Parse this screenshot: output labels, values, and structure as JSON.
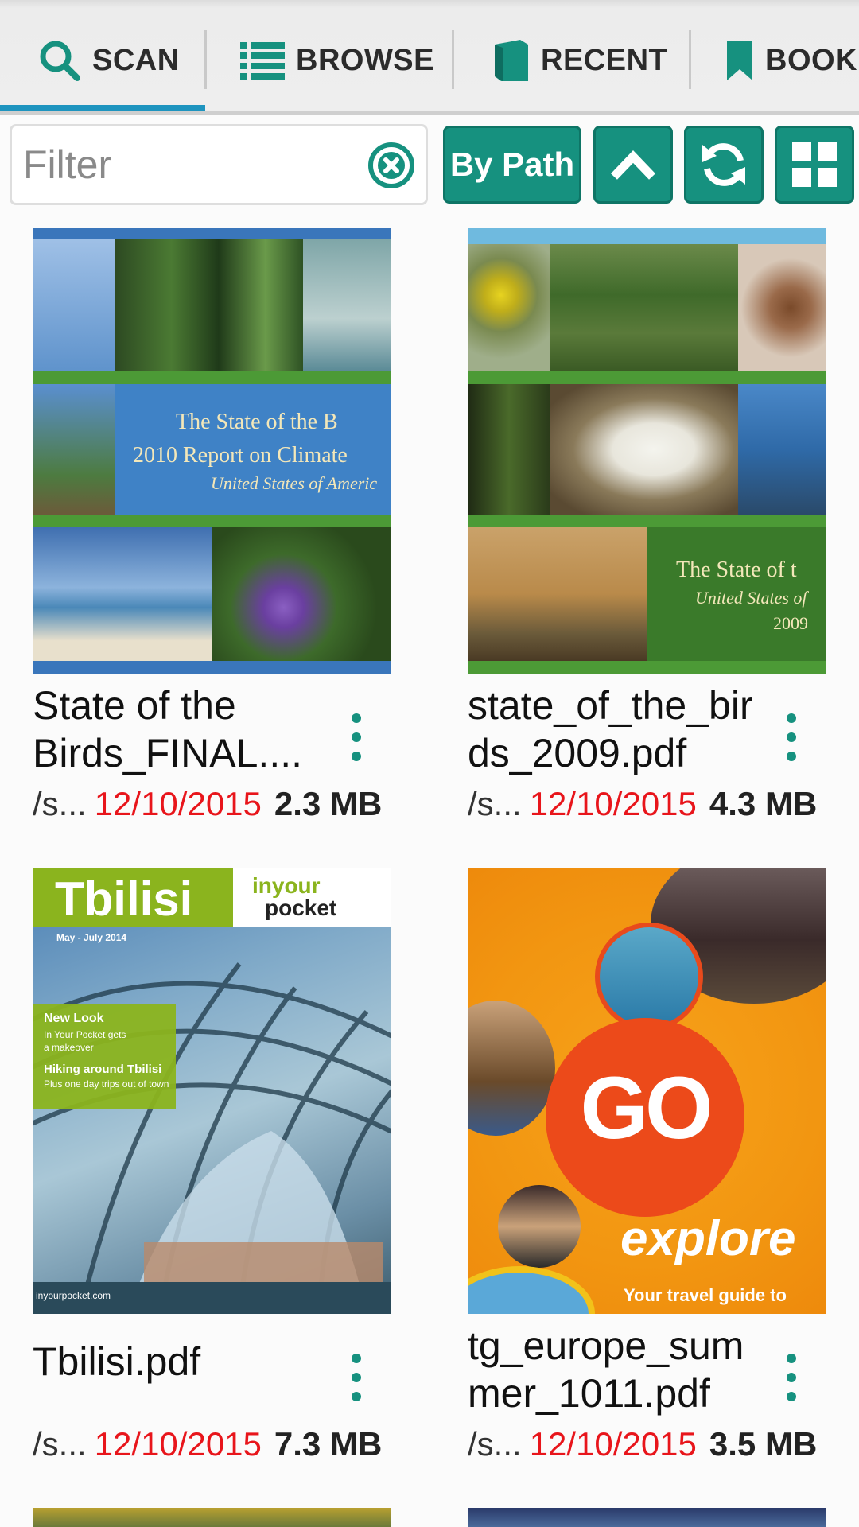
{
  "tabs": [
    {
      "label": "SCAN",
      "icon": "search-icon"
    },
    {
      "label": "BROWSE",
      "icon": "list-icon"
    },
    {
      "label": "RECENT",
      "icon": "book-icon"
    },
    {
      "label": "BOOKM",
      "icon": "bookmark-icon"
    }
  ],
  "toolbar": {
    "filter_placeholder": "Filter",
    "bypath_label": "By Path",
    "colors": {
      "accent": "#16917f",
      "tab_indicator": "#1e94bf",
      "date": "#e8151b"
    }
  },
  "files": [
    {
      "name": "State of the Birds_FINAL....",
      "path": "/s...",
      "date": "12/10/2015",
      "size": "2.3 MB",
      "cover": {
        "line1": "The State of the B",
        "line2": "2010 Report on Climate",
        "line3": "United States of Americ"
      }
    },
    {
      "name": "state_of_the_birds_2009.pdf",
      "path": "/s...",
      "date": "12/10/2015",
      "size": "4.3 MB",
      "cover": {
        "line1": "The State of t",
        "line2": "United States of",
        "line3": "2009"
      }
    },
    {
      "name": "Tbilisi.pdf",
      "path": "/s...",
      "date": "12/10/2015",
      "size": "7.3 MB",
      "cover": {
        "title": "Tbilisi",
        "brand1": "inyour",
        "brand2": "pocket",
        "issue": "May - July 2014",
        "line1": "New Look",
        "line2": "In Your Pocket gets",
        "line3": "a makeover",
        "line4": "Hiking around Tbilisi",
        "line5": "Plus one day trips out of town",
        "footer": "inyourpocket.com"
      }
    },
    {
      "name": "tg_europe_summer_1011.pdf",
      "path": "/s...",
      "date": "12/10/2015",
      "size": "3.5 MB",
      "cover": {
        "go": "GO",
        "explore": "explore",
        "tagline": "Your travel guide to"
      }
    }
  ]
}
